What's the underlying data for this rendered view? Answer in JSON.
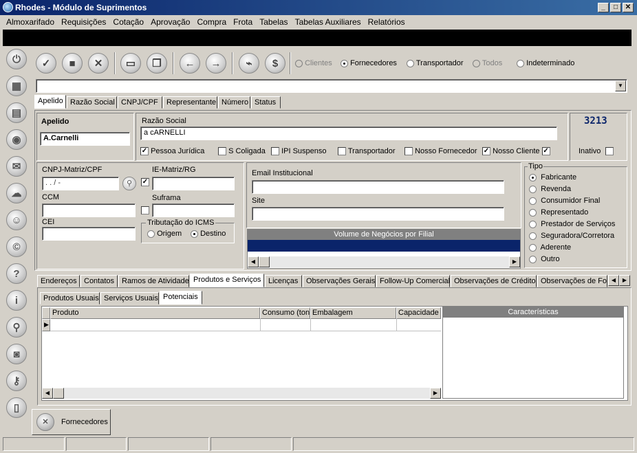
{
  "window": {
    "title": "Rhodes - Módulo de Suprimentos",
    "minimize": "_",
    "maximize": "□",
    "close": "✕"
  },
  "menu": [
    "Almoxarifado",
    "Requisições",
    "Cotação",
    "Aprovação",
    "Compra",
    "Frota",
    "Tabelas",
    "Tabelas Auxiliares",
    "Relatórios"
  ],
  "toolbar": {
    "icons": [
      "check-icon",
      "document-icon",
      "cancel-icon",
      "window-icon",
      "windows-icon",
      "arrow-left-icon",
      "arrow-right-icon",
      "chart-icon",
      "dollar-icon"
    ],
    "glyphs": [
      "✓",
      "■",
      "✕",
      "▭",
      "❐",
      "←",
      "→",
      "⌁",
      "$"
    ],
    "radios": [
      {
        "label": "Clientes",
        "checked": false,
        "disabled": true
      },
      {
        "label": "Fornecedores",
        "checked": true,
        "disabled": false
      },
      {
        "label": "Transportador",
        "checked": false,
        "disabled": false
      },
      {
        "label": "Todos",
        "checked": false,
        "disabled": true
      },
      {
        "label": "Indeterminado",
        "checked": false,
        "disabled": false
      }
    ]
  },
  "sidebar": {
    "icons": [
      "power-icon",
      "calculator-icon",
      "grid-icon",
      "globe-icon",
      "mail-icon",
      "chat-icon",
      "user-icon",
      "copyright-icon",
      "help-icon",
      "info-icon",
      "search-icon",
      "camera-icon",
      "key-icon",
      "mobile-icon"
    ],
    "glyphs": [
      "⏻",
      "▦",
      "▤",
      "◉",
      "✉",
      "☁",
      "☺",
      "©",
      "?",
      "i",
      "⚲",
      "◙",
      "⚷",
      "▯"
    ]
  },
  "search": {
    "value": ""
  },
  "search_tabs": [
    "Apelido",
    "Razão Social",
    "CNPJ/CPF",
    "Representante",
    "Número",
    "Status"
  ],
  "record": {
    "apelido_label": "Apelido",
    "apelido": "A.Carnelli",
    "razao_label": "Razão Social",
    "razao": "a cARNELLI",
    "number": "3213",
    "flags": [
      {
        "label": "Pessoa Jurídica",
        "checked": true
      },
      {
        "label": "S Coligada",
        "checked": false
      },
      {
        "label": "IPI Suspenso",
        "checked": false
      },
      {
        "label": "Transportador",
        "checked": false
      },
      {
        "label": "Nosso Fornecedor",
        "checked": false
      },
      {
        "label": "Nosso Cliente",
        "checked": true
      }
    ],
    "inativo_label": "Inativo",
    "cnpj_label": "CNPJ-Matriz/CPF",
    "cnpj": ". . / -",
    "ie_label": "IE-Matriz/RG",
    "ccm_label": "CCM",
    "suframa_label": "Suframa",
    "cei_label": "CEI",
    "icms_label": "Tributação do ICMS",
    "icms_origem": "Origem",
    "icms_destino": "Destino",
    "email_label": "Email Institucional",
    "site_label": "Site",
    "volume_label": "Volume de Negócios por Filial",
    "tipo_label": "Tipo",
    "tipos": [
      {
        "label": "Fabricante",
        "checked": true
      },
      {
        "label": "Revenda",
        "checked": false
      },
      {
        "label": "Consumidor Final",
        "checked": false
      },
      {
        "label": "Representado",
        "checked": false
      },
      {
        "label": "Prestador de Serviços",
        "checked": false
      },
      {
        "label": "Seguradora/Corretora",
        "checked": false
      },
      {
        "label": "Aderente",
        "checked": false
      },
      {
        "label": "Outro",
        "checked": false
      }
    ]
  },
  "detail_tabs": [
    "Endereços",
    "Contatos",
    "Ramos de Atividade",
    "Produtos e Serviços",
    "Licenças",
    "Observações Gerais",
    "Follow-Up Comercial",
    "Observações de Crédito",
    "Observações de Fo"
  ],
  "sub_tabs": [
    "Produtos Usuais",
    "Serviços Usuais",
    "Potenciais"
  ],
  "grid": {
    "columns": [
      "Produto",
      "Consumo (ton)",
      "Embalagem",
      "Capacidade"
    ],
    "caracteristicas": "Características"
  },
  "bottom_tab": {
    "label": "Fornecedores"
  },
  "colors": {
    "title": "#0a246a",
    "accent": "#0a246a",
    "number": "#0a246a"
  }
}
